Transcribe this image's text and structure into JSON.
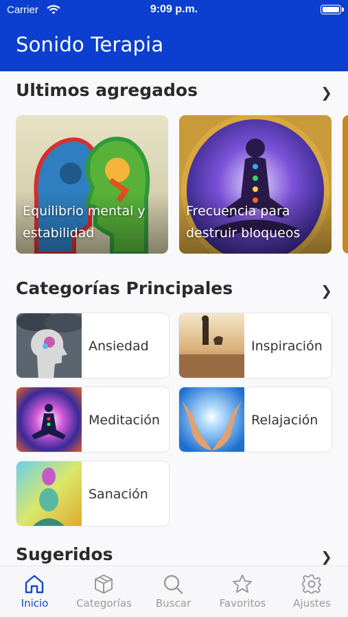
{
  "status_bar": {
    "carrier": "Carrier",
    "time": "9:09 p.m."
  },
  "nav": {
    "title": "Sonido Terapia"
  },
  "latest": {
    "title": "Ultimos agregados",
    "items": [
      {
        "label": "Equilibrio mental y estabilidad"
      },
      {
        "label": "Frecuencia para destruir bloqueos"
      }
    ]
  },
  "categories": {
    "title": "Categorías Principales",
    "items": [
      {
        "label": "Ansiedad"
      },
      {
        "label": "Inspiración"
      },
      {
        "label": "Meditación"
      },
      {
        "label": "Relajación"
      },
      {
        "label": "Sanación"
      }
    ]
  },
  "suggested": {
    "title": "Sugeridos"
  },
  "tabs": [
    {
      "label": "Inicio",
      "icon": "home-icon",
      "active": true
    },
    {
      "label": "Categorías",
      "icon": "box-icon",
      "active": false
    },
    {
      "label": "Buscar",
      "icon": "search-icon",
      "active": false
    },
    {
      "label": "Favoritos",
      "icon": "star-icon",
      "active": false
    },
    {
      "label": "Ajustes",
      "icon": "gear-icon",
      "active": false
    }
  ],
  "colors": {
    "brand": "#0c3fd0",
    "active_tab": "#1345cf",
    "inactive_tab": "#9a9a9a"
  }
}
